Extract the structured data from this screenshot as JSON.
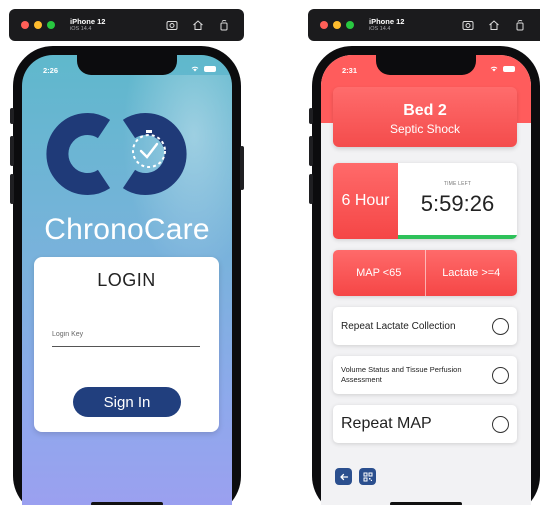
{
  "simulators": [
    {
      "device": "iPhone 12",
      "os": "iOS 14.4"
    },
    {
      "device": "iPhone 12",
      "os": "iOS 14.4"
    }
  ],
  "colors": {
    "traffic_red": "#ff5f57",
    "traffic_yellow": "#febc2e",
    "traffic_green": "#28c840",
    "brand_navy": "#213f7e",
    "alert_red": "#f54646",
    "progress_green": "#2ec15a"
  },
  "login_screen": {
    "status_time": "2:26",
    "brand_name": "ChronoCare",
    "card_title": "LOGIN",
    "key_placeholder": "Login Key",
    "key_value": "",
    "sign_in_label": "Sign In"
  },
  "bed_screen": {
    "status_time": "2:31",
    "bed_name": "Bed 2",
    "condition": "Septic Shock",
    "timer": {
      "bundle_label": "6 Hour",
      "time_left_label": "TIME LEFT",
      "time_left_value": "5:59:26",
      "progress_fraction": 0.998
    },
    "criteria": [
      "MAP <65",
      "Lactate >=4"
    ],
    "tasks": [
      {
        "label": "Repeat Lactate Collection",
        "checked": false
      },
      {
        "label": "Volume Status and Tissue Perfusion Assessment",
        "checked": false
      },
      {
        "label": "Repeat MAP",
        "checked": false
      }
    ],
    "nav": {
      "back_icon": "arrow-left-icon",
      "qr_icon": "qr-code-icon"
    }
  }
}
